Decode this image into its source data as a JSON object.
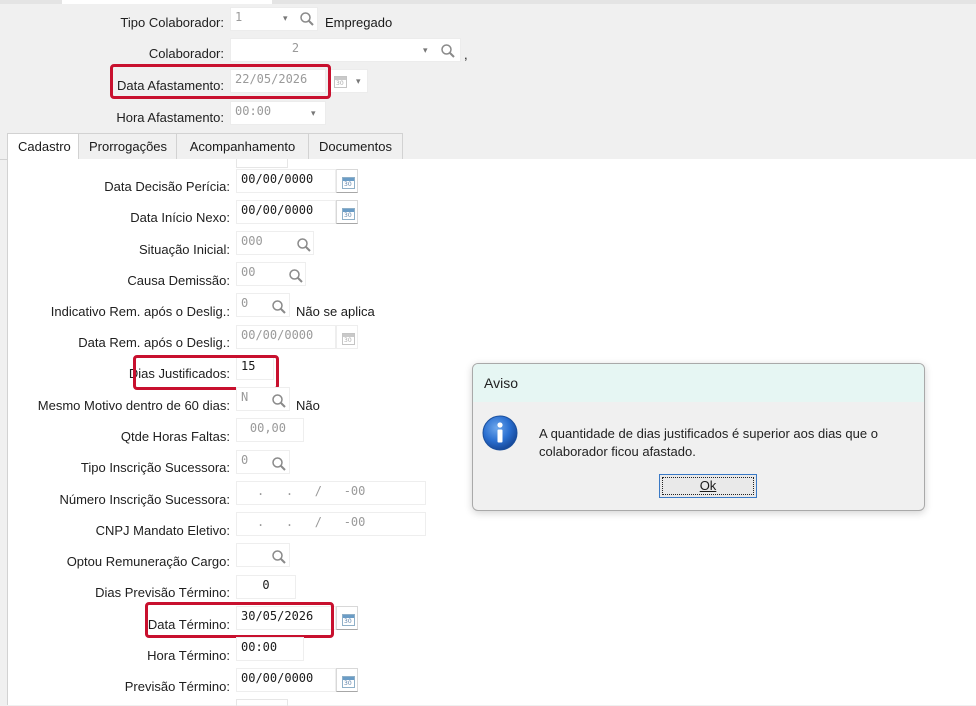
{
  "header": {
    "tipo_colaborador_label": "Tipo Colaborador:",
    "tipo_colaborador_value": "1",
    "tipo_colaborador_desc": "Empregado",
    "colaborador_label": "Colaborador:",
    "colaborador_value": "2",
    "colaborador_trailing": ",",
    "data_afastamento_label": "Data Afastamento:",
    "data_afastamento_value": "22/05/2026",
    "hora_afastamento_label": "Hora Afastamento:",
    "hora_afastamento_value": "00:00"
  },
  "tabs": [
    {
      "label": "Cadastro",
      "active": true
    },
    {
      "label": "Prorrogações",
      "active": false
    },
    {
      "label": "Acompanhamento",
      "active": false
    },
    {
      "label": "Documentos",
      "active": false
    }
  ],
  "form": {
    "data_decisao_pericia": {
      "label": "Data Decisão Perícia:",
      "value": "00/00/0000"
    },
    "data_inicio_nexo": {
      "label": "Data Início Nexo:",
      "value": "00/00/0000"
    },
    "situacao_inicial": {
      "label": "Situação Inicial:",
      "value": "000"
    },
    "causa_demissao": {
      "label": "Causa Demissão:",
      "value": "00"
    },
    "indicativo_rem": {
      "label": "Indicativo Rem. após o Deslig.:",
      "value": "0",
      "desc": "Não se aplica"
    },
    "data_rem": {
      "label": "Data Rem. após o Deslig.:",
      "value": "00/00/0000"
    },
    "dias_justificados": {
      "label": "Dias Justificados:",
      "value": "15"
    },
    "mesmo_motivo": {
      "label": "Mesmo Motivo dentro de 60 dias:",
      "value": "N",
      "desc": "Não"
    },
    "qtde_horas_faltas": {
      "label": "Qtde Horas Faltas:",
      "value": "00,00"
    },
    "tipo_inscricao": {
      "label": "Tipo Inscrição Sucessora:",
      "value": "0"
    },
    "numero_inscricao": {
      "label": "Número Inscrição Sucessora:",
      "value": ".   .   /   -00"
    },
    "cnpj_mandato": {
      "label": "CNPJ Mandato Eletivo:",
      "value": ".   .   /   -00"
    },
    "optou_remuneracao": {
      "label": "Optou Remuneração Cargo:",
      "value": ""
    },
    "dias_previsao": {
      "label": "Dias Previsão Término:",
      "value": "0"
    },
    "data_termino": {
      "label": "Data Término:",
      "value": "30/05/2026"
    },
    "hora_termino": {
      "label": "Hora Término:",
      "value": "00:00"
    },
    "previsao_termino": {
      "label": "Previsão Término:",
      "value": "00/00/0000"
    }
  },
  "calendar_icon_text": "30",
  "dialog": {
    "title": "Aviso",
    "message": "A quantidade de dias justificados é superior aos dias que o colaborador ficou afastado.",
    "ok_label": "Ok"
  },
  "colors": {
    "highlight": "#c8102e",
    "dialog_title_bg": "#e6f6f3",
    "info_icon": "#1f5fbf"
  }
}
